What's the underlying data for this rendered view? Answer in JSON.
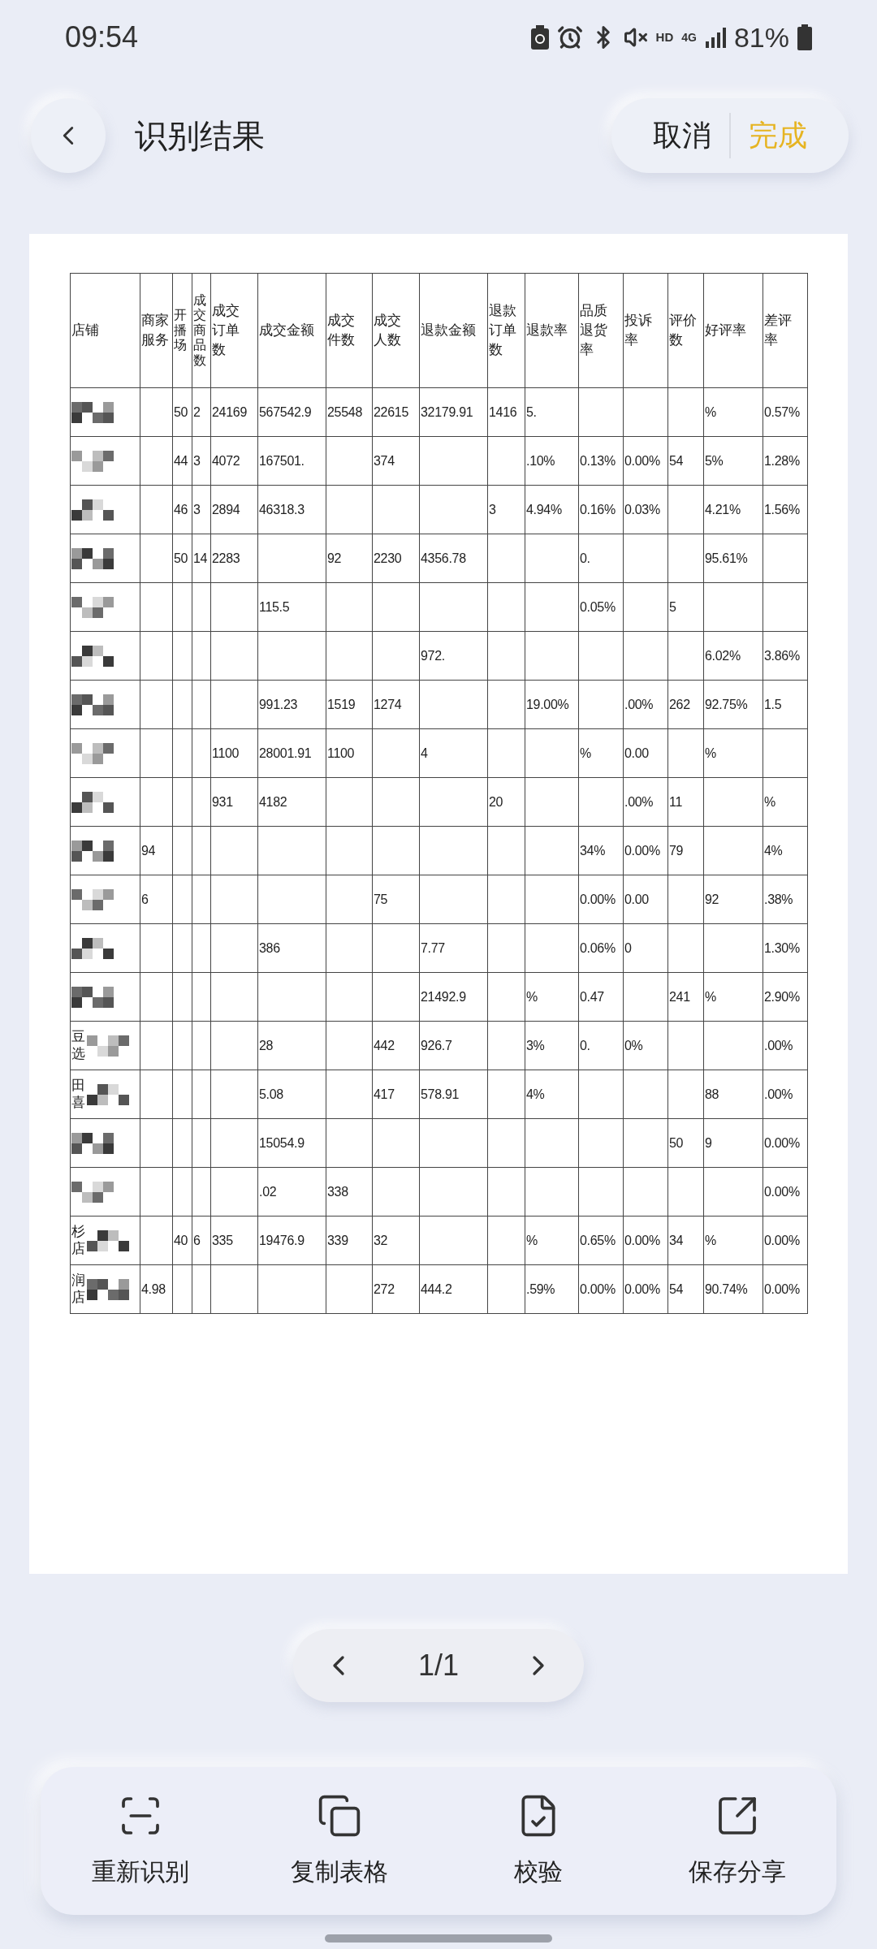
{
  "status_bar": {
    "time": "09:54",
    "network": "HD",
    "cellular": "4G",
    "battery": "81%"
  },
  "header": {
    "title": "识别结果",
    "cancel": "取消",
    "done": "完成"
  },
  "table": {
    "header": {
      "store": "店铺",
      "merchant_service": "商家服务",
      "live_sessions": "开播场",
      "products_sold": "成交商品数",
      "orders": "成交订单数",
      "sales_amount": "成交金额",
      "items_sold": "成交件数",
      "buyers": "成交人数",
      "refund_amount": "退款金额",
      "refund_orders": "退款订单数",
      "refund_rate": "退款率",
      "quality_return_rate": "品质退货率",
      "complaint_rate": "投诉率",
      "reviews": "评价数",
      "positive_rate": "好评率",
      "negative_rate": "差评率"
    },
    "rows": [
      {
        "live_sessions": "50",
        "products_sold": "2",
        "orders": "24169",
        "sales_amount": "567542.9",
        "items_sold": "25548",
        "buyers": "22615",
        "refund_amount": "32179.91",
        "refund_orders": "1416",
        "refund_rate": "5.",
        "positive_rate": "%",
        "negative_rate": "0.57%"
      },
      {
        "live_sessions": "44",
        "products_sold": "3",
        "orders": "4072",
        "sales_amount": "167501.",
        "buyers": "374",
        "refund_rate": ".10%",
        "quality_return_rate": "0.13%",
        "complaint_rate": "0.00%",
        "reviews": "54",
        "positive_rate": "5%",
        "negative_rate": "1.28%"
      },
      {
        "live_sessions": "46",
        "products_sold": "3",
        "orders": "2894",
        "sales_amount": "46318.3",
        "refund_orders": "3",
        "refund_rate": "4.94%",
        "quality_return_rate": "0.16%",
        "complaint_rate": "0.03%",
        "positive_rate": "4.21%",
        "negative_rate": "1.56%"
      },
      {
        "live_sessions": "50",
        "products_sold": "14",
        "orders": "2283",
        "items_sold": "92",
        "buyers": "2230",
        "refund_amount": "4356.78",
        "quality_return_rate": "0.",
        "positive_rate": "95.61%"
      },
      {
        "sales_amount": "115.5",
        "quality_return_rate": "0.05%",
        "reviews": "5"
      },
      {
        "refund_amount": "972.",
        "positive_rate": "6.02%",
        "negative_rate": "3.86%"
      },
      {
        "sales_amount": "991.23",
        "items_sold": "1519",
        "buyers": "1274",
        "refund_rate": "19.00%",
        "complaint_rate": ".00%",
        "reviews": "262",
        "positive_rate": "92.75%",
        "negative_rate": "1.5"
      },
      {
        "orders": "1100",
        "sales_amount": "28001.91",
        "items_sold": "1100",
        "refund_amount": "4",
        "quality_return_rate": "%",
        "complaint_rate": "0.00",
        "positive_rate": "%"
      },
      {
        "orders": "931",
        "sales_amount": "4182",
        "refund_orders": "20",
        "complaint_rate": ".00%",
        "reviews": "11",
        "negative_rate": "%"
      },
      {
        "merchant_service": "94",
        "quality_return_rate": "34%",
        "complaint_rate": "0.00%",
        "reviews": "79",
        "negative_rate": "4%"
      },
      {
        "merchant_service": "6",
        "buyers": "75",
        "quality_return_rate": "0.00%",
        "complaint_rate": "0.00",
        "positive_rate": "92",
        "negative_rate": ".38%"
      },
      {
        "sales_amount": "386",
        "refund_amount": "7.77",
        "quality_return_rate": "0.06%",
        "complaint_rate": "0",
        "negative_rate": "1.30%"
      },
      {
        "refund_amount": "21492.9",
        "refund_rate": "%",
        "quality_return_rate": "0.47",
        "reviews": "241",
        "positive_rate": "%",
        "negative_rate": "2.90%"
      },
      {
        "store": "豆选",
        "sales_amount": "28",
        "buyers": "442",
        "refund_amount": "926.7",
        "refund_rate": "3%",
        "quality_return_rate": "0.",
        "complaint_rate": "0%",
        "negative_rate": ".00%"
      },
      {
        "store": "田喜",
        "sales_amount": "5.08",
        "buyers": "417",
        "refund_amount": "578.91",
        "refund_rate": "4%",
        "positive_rate": "88",
        "negative_rate": ".00%"
      },
      {
        "sales_amount": "15054.9",
        "reviews": "50",
        "positive_rate": "9",
        "negative_rate": "0.00%"
      },
      {
        "sales_amount": ".02",
        "items_sold": "338",
        "negative_rate": "0.00%"
      },
      {
        "store": "杉店",
        "live_sessions": "40",
        "products_sold": "6",
        "orders": "335",
        "sales_amount": "19476.9",
        "items_sold": "339",
        "buyers": "32",
        "refund_rate": "%",
        "quality_return_rate": "0.65%",
        "complaint_rate": "0.00%",
        "reviews": "34",
        "positive_rate": "%",
        "negative_rate": "0.00%"
      },
      {
        "store": "润店",
        "merchant_service": "4.98",
        "buyers": "272",
        "refund_amount": "444.2",
        "refund_rate": ".59%",
        "quality_return_rate": "0.00%",
        "complaint_rate": "0.00%",
        "reviews": "54",
        "positive_rate": "90.74%",
        "negative_rate": "0.00%"
      }
    ]
  },
  "pager": {
    "page": "1/1"
  },
  "actions": [
    {
      "kind": "rescan",
      "label": "重新识别"
    },
    {
      "kind": "copy",
      "label": "复制表格"
    },
    {
      "kind": "check",
      "label": "校验"
    },
    {
      "kind": "share",
      "label": "保存分享"
    }
  ]
}
